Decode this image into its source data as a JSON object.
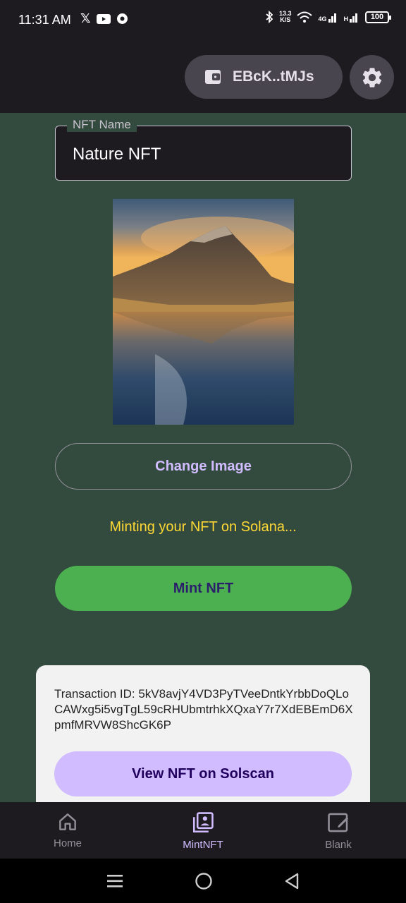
{
  "status_bar": {
    "time": "11:31 AM",
    "network_speed_value": "13.3",
    "network_speed_unit": "K/S",
    "network_type": "4G",
    "network_type_2": "H",
    "battery": "100"
  },
  "header": {
    "wallet_address": "EBcK..tMJs"
  },
  "form": {
    "name_label": "NFT Name",
    "name_value": "Nature NFT"
  },
  "actions": {
    "change_image_label": "Change Image",
    "minting_status": "Minting your NFT on Solana...",
    "mint_label": "Mint NFT"
  },
  "transaction": {
    "text": "Transaction ID: 5kV8avjY4VD3PyTVeeDntkYrbbDoQLoCAWxg5i5vgTgL59cRHUbmtrhkXQxaY7r7XdEBEmD6XpmfMRVW8ShcGK6P",
    "view_label": "View NFT on Solscan"
  },
  "bottom_nav": {
    "items": [
      {
        "label": "Home",
        "icon": "home-icon"
      },
      {
        "label": "MintNFT",
        "icon": "gallery-icon",
        "active": true
      },
      {
        "label": "Blank",
        "icon": "edit-icon"
      }
    ]
  },
  "colors": {
    "background": "#334b3e",
    "primary": "#d0bcff",
    "mint_button": "#4caf50",
    "status_text": "#fdd835"
  }
}
